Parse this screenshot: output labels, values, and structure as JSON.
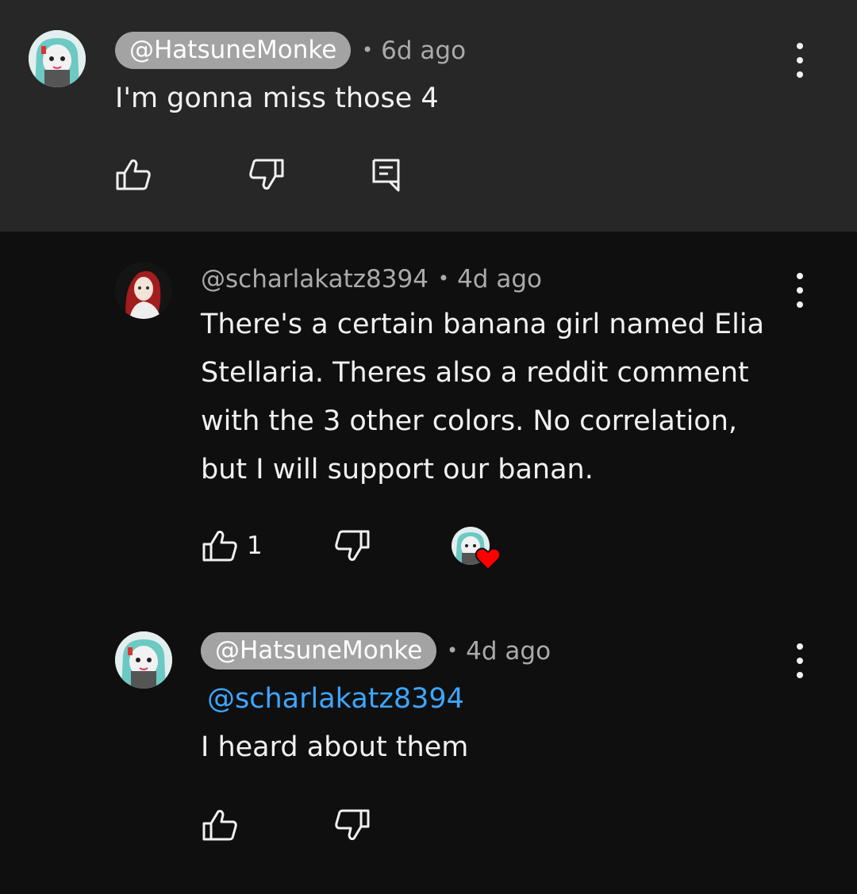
{
  "comments": [
    {
      "author": "@HatsuneMonke",
      "author_chip": true,
      "time": "6d ago",
      "text": "I'm gonna miss those 4",
      "actions": {
        "like_icon": "thumb-up-icon",
        "dislike_icon": "thumb-down-icon",
        "reply_icon": "reply-icon"
      }
    },
    {
      "author": "@scharlakatz8394",
      "author_chip": false,
      "time": "4d ago",
      "text_lines": [
        "There's a certain banana girl named Elia",
        "Stellaria. Theres also a reddit comment",
        "with the 3 other colors. No correlation,",
        "but I will support our banan."
      ],
      "like_count": "1",
      "creator_heart": true
    },
    {
      "author": "@HatsuneMonke",
      "author_chip": true,
      "time": "4d ago",
      "mention": "@scharlakatz8394",
      "text": "I heard about them"
    }
  ],
  "colors": {
    "top_background": "#272727",
    "page_background": "#0f0f0f",
    "chip": "#a3a3a3",
    "mention": "#3ea6ff",
    "heart": "#ff0000"
  }
}
